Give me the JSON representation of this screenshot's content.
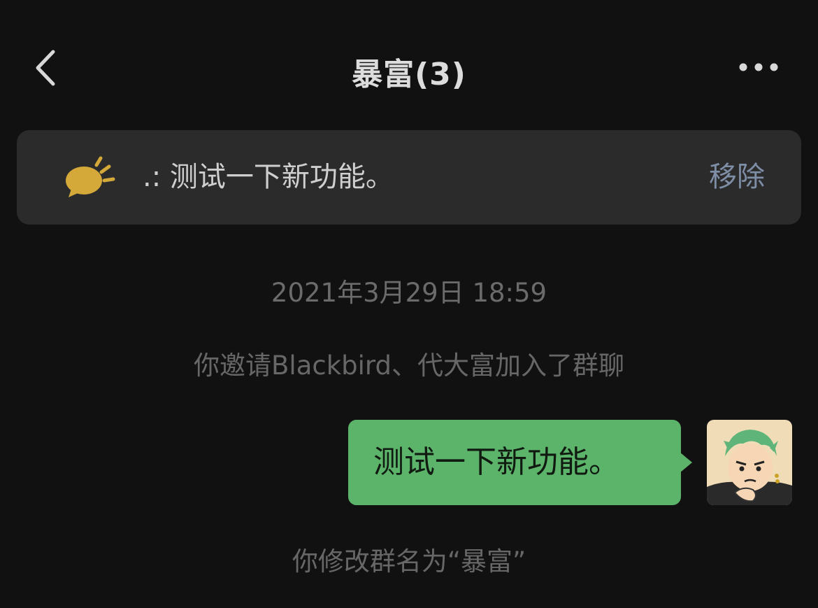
{
  "header": {
    "title": "暴富(3)",
    "back_icon": "chevron-left-icon",
    "more_icon": "more-dots-icon"
  },
  "pinned": {
    "icon": "speaker-bubble-icon",
    "text": ".: 测试一下新功能。",
    "remove_label": "移除",
    "icon_color": "#d4a93a",
    "remove_color": "#7e8ea6"
  },
  "chat": {
    "timestamp": "2021年3月29日 18:59",
    "system_invite": "你邀请Blackbird、代大富加入了群聊",
    "message": {
      "text": "测试一下新功能。",
      "bubble_color": "#5cb36a",
      "avatar": "avatar-icon"
    },
    "system_rename": "你修改群名为“暴富”"
  }
}
